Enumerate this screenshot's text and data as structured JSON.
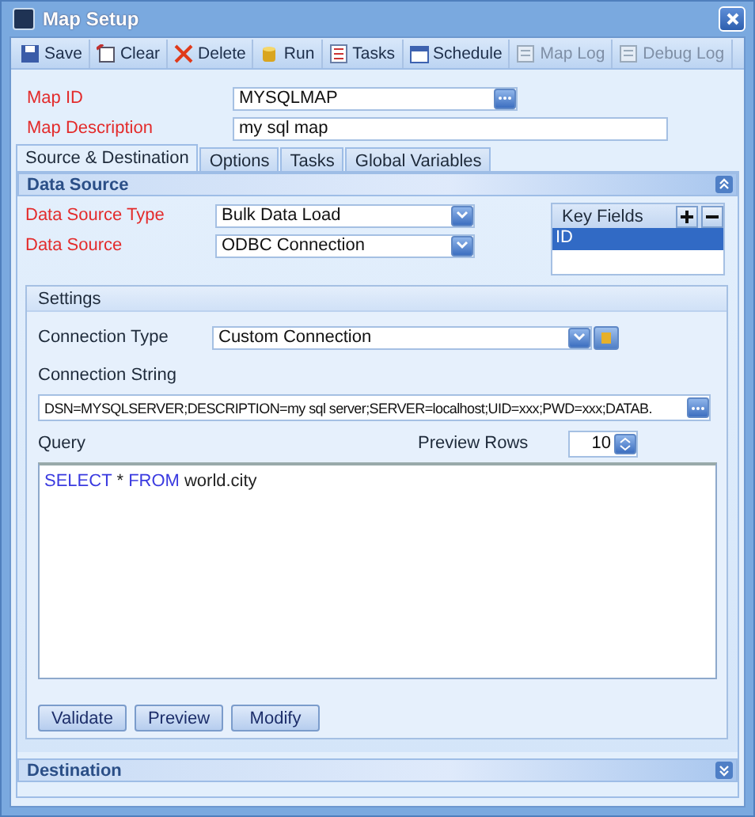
{
  "window": {
    "title": "Map Setup"
  },
  "toolbar": [
    {
      "label": "Save",
      "disabled": false
    },
    {
      "label": "Clear",
      "disabled": false
    },
    {
      "label": "Delete",
      "disabled": false
    },
    {
      "label": "Run",
      "disabled": false
    },
    {
      "label": "Tasks",
      "disabled": false
    },
    {
      "label": "Schedule",
      "disabled": false
    },
    {
      "label": "Map Log",
      "disabled": true
    },
    {
      "label": "Debug Log",
      "disabled": true
    }
  ],
  "map_id": {
    "label": "Map ID",
    "value": "MYSQLMAP"
  },
  "map_description": {
    "label": "Map Description",
    "value": "my sql map"
  },
  "tabs": [
    {
      "label": "Source & Destination",
      "selected": true
    },
    {
      "label": "Options",
      "selected": false
    },
    {
      "label": "Tasks",
      "selected": false
    },
    {
      "label": "Global Variables",
      "selected": false
    }
  ],
  "data_source": {
    "title": "Data Source",
    "expanded": true,
    "fields": [
      {
        "label": "Data Source Type",
        "value": "Bulk Data Load"
      },
      {
        "label": "Data Source",
        "value": "ODBC Connection"
      }
    ],
    "key_fields": {
      "title": "Key Fields",
      "items": [
        {
          "label": "ID",
          "selected": true
        }
      ]
    },
    "settings": {
      "title": "Settings",
      "connection_type": {
        "label": "Connection Type",
        "value": "Custom Connection"
      },
      "connection_string": {
        "label": "Connection String",
        "value": "DSN=MYSQLSERVER;DESCRIPTION=my sql server;SERVER=localhost;UID=xxx;PWD=xxx;DATAB."
      },
      "query": {
        "label": "Query",
        "tokens": [
          {
            "text": "SELECT",
            "kind": "keyword"
          },
          {
            "text": "*",
            "kind": "plain"
          },
          {
            "text": "FROM",
            "kind": "keyword"
          },
          {
            "text": "world.city",
            "kind": "plain"
          }
        ]
      },
      "preview_rows": {
        "label": "Preview Rows",
        "value": "10"
      },
      "buttons": [
        "Validate",
        "Preview",
        "Modify"
      ]
    }
  },
  "destination": {
    "title": "Destination",
    "expanded": false
  }
}
